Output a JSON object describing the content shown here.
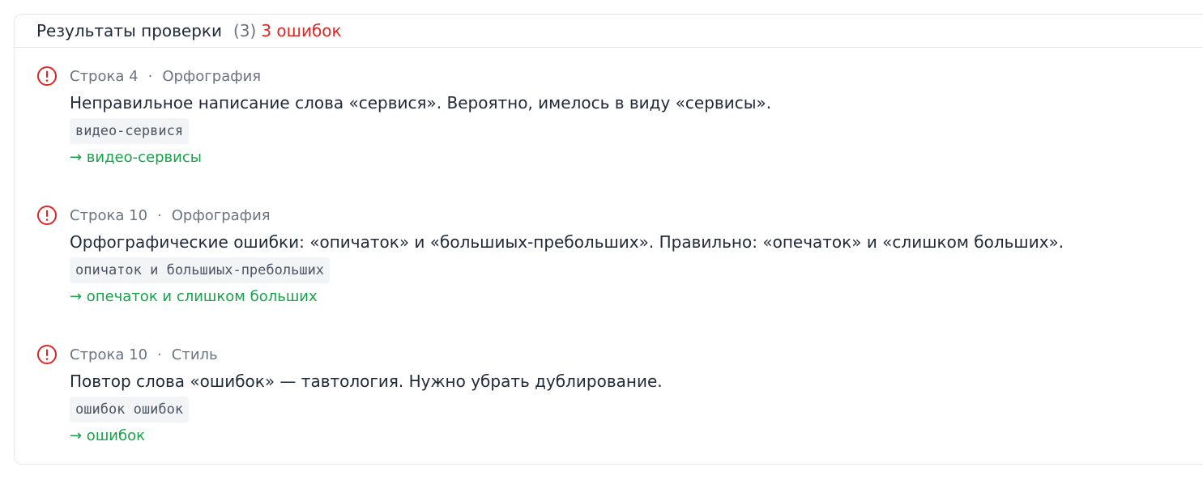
{
  "header": {
    "title": "Результаты проверки",
    "count": "(3)",
    "errors": "3 ошибок"
  },
  "colors": {
    "error": "#dc2626",
    "fix": "#16a34a",
    "muted": "#6b7280"
  },
  "issues": [
    {
      "icon": "error-circle-icon",
      "line": "Строка 4",
      "separator": "·",
      "category": "Орфография",
      "message": "Неправильное написание слова «сервися». Вероятно, имелось в виду «сервисы».",
      "snippet": "видео-сервися",
      "fix": "→ видео-сервисы"
    },
    {
      "icon": "error-circle-icon",
      "line": "Строка 10",
      "separator": "·",
      "category": "Орфография",
      "message": "Орфографические ошибки: «опичаток» и «большиых-пребольших». Правильно: «опечаток» и «слишком больших».",
      "snippet": "опичаток и большиых-пребольших",
      "fix": "→ опечаток и слишком больших"
    },
    {
      "icon": "error-circle-icon",
      "line": "Строка 10",
      "separator": "·",
      "category": "Стиль",
      "message": "Повтор слова «ошибок» — тавтология. Нужно убрать дублирование.",
      "snippet": "ошибок ошибок",
      "fix": "→ ошибок"
    }
  ]
}
